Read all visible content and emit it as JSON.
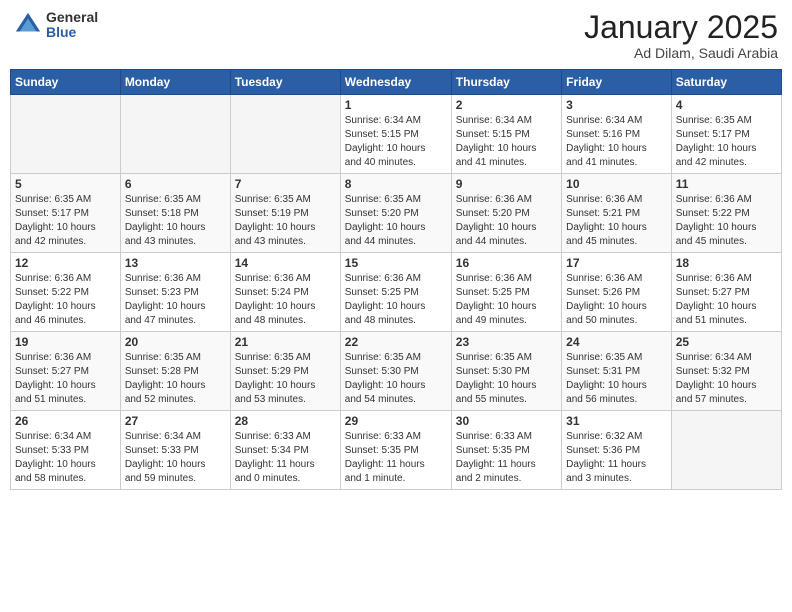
{
  "header": {
    "logo_general": "General",
    "logo_blue": "Blue",
    "month": "January 2025",
    "location": "Ad Dilam, Saudi Arabia"
  },
  "weekdays": [
    "Sunday",
    "Monday",
    "Tuesday",
    "Wednesday",
    "Thursday",
    "Friday",
    "Saturday"
  ],
  "weeks": [
    [
      {
        "day": "",
        "info": ""
      },
      {
        "day": "",
        "info": ""
      },
      {
        "day": "",
        "info": ""
      },
      {
        "day": "1",
        "info": "Sunrise: 6:34 AM\nSunset: 5:15 PM\nDaylight: 10 hours\nand 40 minutes."
      },
      {
        "day": "2",
        "info": "Sunrise: 6:34 AM\nSunset: 5:15 PM\nDaylight: 10 hours\nand 41 minutes."
      },
      {
        "day": "3",
        "info": "Sunrise: 6:34 AM\nSunset: 5:16 PM\nDaylight: 10 hours\nand 41 minutes."
      },
      {
        "day": "4",
        "info": "Sunrise: 6:35 AM\nSunset: 5:17 PM\nDaylight: 10 hours\nand 42 minutes."
      }
    ],
    [
      {
        "day": "5",
        "info": "Sunrise: 6:35 AM\nSunset: 5:17 PM\nDaylight: 10 hours\nand 42 minutes."
      },
      {
        "day": "6",
        "info": "Sunrise: 6:35 AM\nSunset: 5:18 PM\nDaylight: 10 hours\nand 43 minutes."
      },
      {
        "day": "7",
        "info": "Sunrise: 6:35 AM\nSunset: 5:19 PM\nDaylight: 10 hours\nand 43 minutes."
      },
      {
        "day": "8",
        "info": "Sunrise: 6:35 AM\nSunset: 5:20 PM\nDaylight: 10 hours\nand 44 minutes."
      },
      {
        "day": "9",
        "info": "Sunrise: 6:36 AM\nSunset: 5:20 PM\nDaylight: 10 hours\nand 44 minutes."
      },
      {
        "day": "10",
        "info": "Sunrise: 6:36 AM\nSunset: 5:21 PM\nDaylight: 10 hours\nand 45 minutes."
      },
      {
        "day": "11",
        "info": "Sunrise: 6:36 AM\nSunset: 5:22 PM\nDaylight: 10 hours\nand 45 minutes."
      }
    ],
    [
      {
        "day": "12",
        "info": "Sunrise: 6:36 AM\nSunset: 5:22 PM\nDaylight: 10 hours\nand 46 minutes."
      },
      {
        "day": "13",
        "info": "Sunrise: 6:36 AM\nSunset: 5:23 PM\nDaylight: 10 hours\nand 47 minutes."
      },
      {
        "day": "14",
        "info": "Sunrise: 6:36 AM\nSunset: 5:24 PM\nDaylight: 10 hours\nand 48 minutes."
      },
      {
        "day": "15",
        "info": "Sunrise: 6:36 AM\nSunset: 5:25 PM\nDaylight: 10 hours\nand 48 minutes."
      },
      {
        "day": "16",
        "info": "Sunrise: 6:36 AM\nSunset: 5:25 PM\nDaylight: 10 hours\nand 49 minutes."
      },
      {
        "day": "17",
        "info": "Sunrise: 6:36 AM\nSunset: 5:26 PM\nDaylight: 10 hours\nand 50 minutes."
      },
      {
        "day": "18",
        "info": "Sunrise: 6:36 AM\nSunset: 5:27 PM\nDaylight: 10 hours\nand 51 minutes."
      }
    ],
    [
      {
        "day": "19",
        "info": "Sunrise: 6:36 AM\nSunset: 5:27 PM\nDaylight: 10 hours\nand 51 minutes."
      },
      {
        "day": "20",
        "info": "Sunrise: 6:35 AM\nSunset: 5:28 PM\nDaylight: 10 hours\nand 52 minutes."
      },
      {
        "day": "21",
        "info": "Sunrise: 6:35 AM\nSunset: 5:29 PM\nDaylight: 10 hours\nand 53 minutes."
      },
      {
        "day": "22",
        "info": "Sunrise: 6:35 AM\nSunset: 5:30 PM\nDaylight: 10 hours\nand 54 minutes."
      },
      {
        "day": "23",
        "info": "Sunrise: 6:35 AM\nSunset: 5:30 PM\nDaylight: 10 hours\nand 55 minutes."
      },
      {
        "day": "24",
        "info": "Sunrise: 6:35 AM\nSunset: 5:31 PM\nDaylight: 10 hours\nand 56 minutes."
      },
      {
        "day": "25",
        "info": "Sunrise: 6:34 AM\nSunset: 5:32 PM\nDaylight: 10 hours\nand 57 minutes."
      }
    ],
    [
      {
        "day": "26",
        "info": "Sunrise: 6:34 AM\nSunset: 5:33 PM\nDaylight: 10 hours\nand 58 minutes."
      },
      {
        "day": "27",
        "info": "Sunrise: 6:34 AM\nSunset: 5:33 PM\nDaylight: 10 hours\nand 59 minutes."
      },
      {
        "day": "28",
        "info": "Sunrise: 6:33 AM\nSunset: 5:34 PM\nDaylight: 11 hours\nand 0 minutes."
      },
      {
        "day": "29",
        "info": "Sunrise: 6:33 AM\nSunset: 5:35 PM\nDaylight: 11 hours\nand 1 minute."
      },
      {
        "day": "30",
        "info": "Sunrise: 6:33 AM\nSunset: 5:35 PM\nDaylight: 11 hours\nand 2 minutes."
      },
      {
        "day": "31",
        "info": "Sunrise: 6:32 AM\nSunset: 5:36 PM\nDaylight: 11 hours\nand 3 minutes."
      },
      {
        "day": "",
        "info": ""
      }
    ]
  ]
}
